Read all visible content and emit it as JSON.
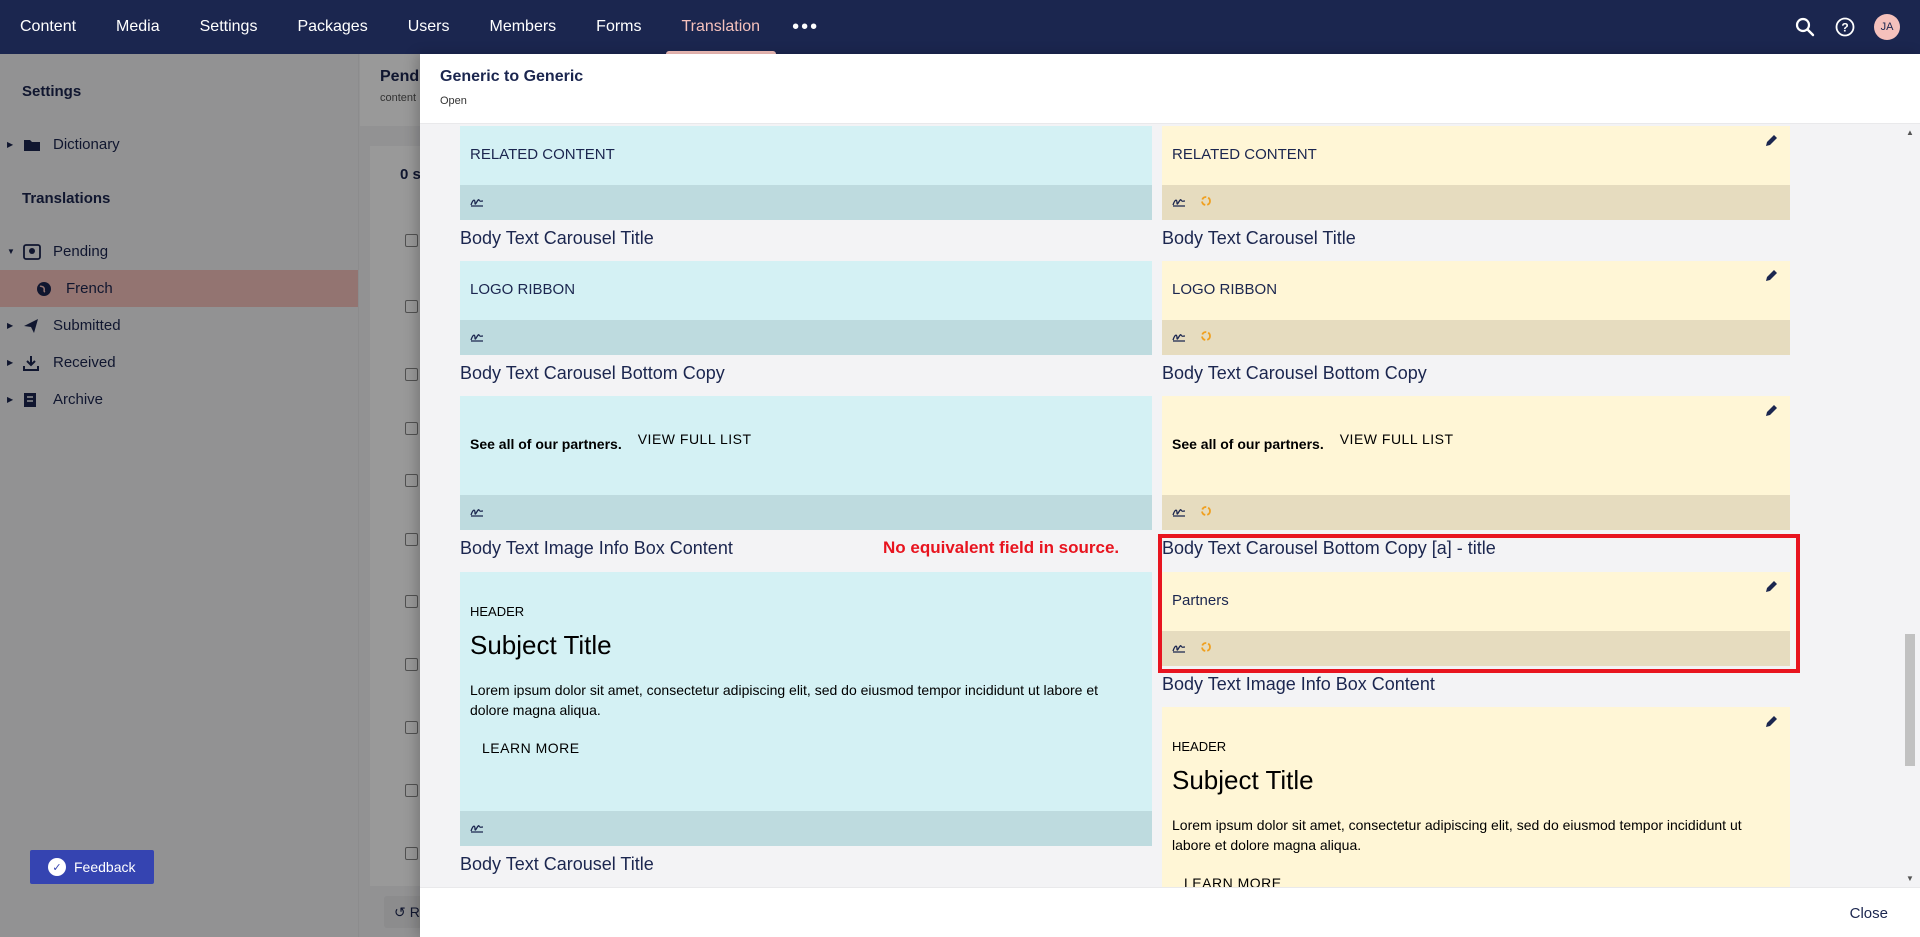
{
  "topnav": {
    "items": [
      "Content",
      "Media",
      "Settings",
      "Packages",
      "Users",
      "Members",
      "Forms",
      "Translation"
    ],
    "active": "Translation",
    "more": "•••",
    "avatar": "JA"
  },
  "sidebar": {
    "settings_heading": "Settings",
    "dictionary": "Dictionary",
    "translations_heading": "Translations",
    "pending": "Pending",
    "french": "French",
    "submitted": "Submitted",
    "received": "Received",
    "archive": "Archive",
    "feedback": "Feedback"
  },
  "background": {
    "title": "Pendi",
    "subtitle": "content",
    "count": "0 s",
    "button": "R"
  },
  "dialog": {
    "title": "Generic to Generic",
    "status": "Open",
    "close": "Close",
    "source": {
      "box1_text": "RELATED CONTENT",
      "label1": "Body Text Carousel Title",
      "box2_text": "LOGO RIBBON",
      "label2": "Body Text Carousel Bottom Copy",
      "box3_partners": "See all of our partners.",
      "box3_link": "VIEW FULL LIST",
      "label3": "Body Text Image Info Box Content",
      "no_equivalent": "No equivalent field in source.",
      "info_header": "HEADER",
      "info_title": "Subject Title",
      "info_lorem": "Lorem ipsum dolor sit amet, consectetur adipiscing elit, sed do eiusmod tempor incididunt ut labore et dolore magna aliqua.",
      "info_learn": "LEARN MORE",
      "label4": "Body Text Carousel Title"
    },
    "target": {
      "box1_text": "RELATED CONTENT",
      "label1": "Body Text Carousel Title",
      "box2_text": "LOGO RIBBON",
      "label2": "Body Text Carousel Bottom Copy",
      "box3_partners": "See all of our partners.",
      "box3_link": "VIEW FULL LIST",
      "label_extra": "Body Text Carousel Bottom Copy [a] - title",
      "extra_text": "Partners",
      "label3": "Body Text Image Info Box Content",
      "info_header": "HEADER",
      "info_title": "Subject Title",
      "info_lorem": "Lorem ipsum dolor sit amet, consectetur adipiscing elit, sed do eiusmod tempor incididunt ut labore et dolore magna aliqua.",
      "info_learn": "LEARN MORE"
    }
  },
  "colors": {
    "nav_bg": "#1b264f",
    "active_accent": "#f5c1bc",
    "source_bg": "#d4f1f4",
    "target_bg": "#fff6d6",
    "warning_red": "#e8141f",
    "status_orange": "#f0a020"
  },
  "icons": {
    "search": "search-icon",
    "help": "help-icon",
    "folder": "folder-icon",
    "globe": "globe-icon",
    "edit": "pencil-icon",
    "tool": "signature-icon",
    "status": "sync-icon"
  }
}
